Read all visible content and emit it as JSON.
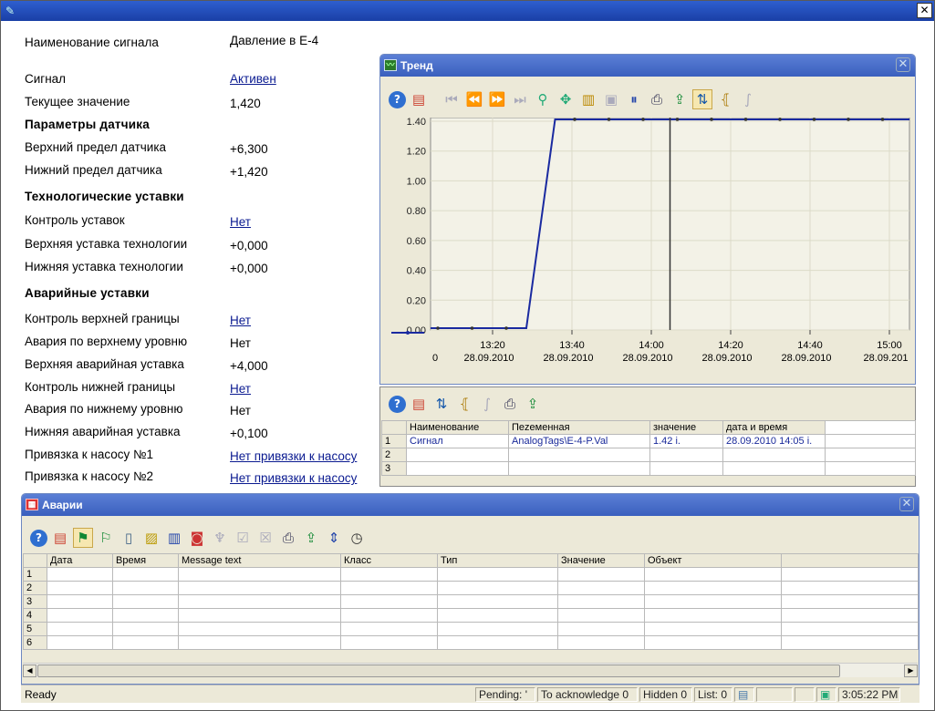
{
  "props": {
    "name_label": "Наименование сигнала",
    "name_value": "Давление в Е-4",
    "signal_label": "Сигнал",
    "signal_value": "Активен",
    "current_label": "Текущее значение",
    "current_value": "1,420",
    "sensor_section": "Параметры датчика",
    "sensor_high_label": "Верхний предел датчика",
    "sensor_high_value": "+6,300",
    "sensor_low_label": "Нижний предел датчика",
    "sensor_low_value": "+1,420",
    "tech_section": "Технологические уставки",
    "tech_ctrl_label": "Контроль уставок",
    "tech_ctrl_value": "Нет",
    "tech_high_label": "Верхняя уставка технологии",
    "tech_high_value": "+0,000",
    "tech_low_label": "Нижняя уставка технологии",
    "tech_low_value": "+0,000",
    "alarm_section": "Аварийные уставки",
    "ctrl_upper_label": "Контроль верхней границы",
    "ctrl_upper_value": "Нет",
    "alarm_upper_label": "Авария по верхнему уровню",
    "alarm_upper_value": "Нет",
    "alarm_upper_set_label": "Верхняя аварийная уставка",
    "alarm_upper_set_value": "+4,000",
    "ctrl_lower_label": "Контроль нижней границы",
    "ctrl_lower_value": "Нет",
    "alarm_lower_label": "Авария по нижнему уровню",
    "alarm_lower_value": "Нет",
    "alarm_lower_set_label": "Нижняя аварийная уставка",
    "alarm_lower_set_value": "+0,100",
    "pump1_label": "Привязка к насосу №1",
    "pump1_value": "Нет привязки к насосу",
    "pump2_label": "Привязка к насосу №2",
    "pump2_value": "Нет привязки к насосу"
  },
  "trend": {
    "title": "Тренд",
    "toolbar": [
      "help-icon",
      "properties-icon",
      "first-icon",
      "rewind-icon",
      "forward-icon",
      "last-icon",
      "zoom-icon",
      "pan-icon",
      "ruler-icon",
      "stats-icon",
      "pause-icon",
      "print-icon",
      "export-icon",
      "select-icon",
      "range-icon",
      "function-icon"
    ],
    "x0_label": "0"
  },
  "chart_data": {
    "type": "line",
    "y_ticks": [
      "1.40",
      "1.20",
      "1.00",
      "0.80",
      "0.60",
      "0.40",
      "0.20",
      "0.00"
    ],
    "ylim": [
      0,
      1.4
    ],
    "x_ticks": [
      {
        "time": "13:20",
        "date": "28.09.2010"
      },
      {
        "time": "13:40",
        "date": "28.09.2010"
      },
      {
        "time": "14:00",
        "date": "28.09.2010"
      },
      {
        "time": "14:20",
        "date": "28.09.2010"
      },
      {
        "time": "14:40",
        "date": "28.09.2010"
      },
      {
        "time": "15:00",
        "date": "28.09.201"
      }
    ],
    "series": [
      {
        "color": "#1a2aa0",
        "points": [
          [
            0,
            0
          ],
          [
            0.2,
            0
          ],
          [
            0.26,
            1.4
          ],
          [
            1,
            1.4
          ]
        ]
      }
    ],
    "cursor_x": 0.5
  },
  "table": {
    "toolbar": [
      "help-icon",
      "properties-icon",
      "select-icon",
      "range-icon",
      "function-icon",
      "print-icon",
      "export-icon"
    ],
    "headers": [
      "Наименование",
      "Пеzеменная",
      "значение",
      "дата и время",
      ""
    ],
    "rows": [
      {
        "n": "1",
        "name": "Сигнал",
        "var": "AnalogTags\\E-4-P.Val",
        "val": "1.42 i.",
        "dt": "28.09.2010 14:05 i."
      },
      {
        "n": "2",
        "name": "",
        "var": "",
        "val": "",
        "dt": ""
      },
      {
        "n": "3",
        "name": "",
        "var": "",
        "val": "",
        "dt": ""
      }
    ]
  },
  "alarms": {
    "title": "Аварии",
    "toolbar": [
      "help-icon",
      "properties-icon",
      "alarm-list-icon",
      "history-icon",
      "archive-icon",
      "lock-icon",
      "statistics-icon",
      "hide-icon",
      "filter-icon",
      "ack-icon",
      "ack-all-icon",
      "print-icon",
      "export-icon",
      "sort-icon",
      "time-icon"
    ],
    "headers": [
      "Дата",
      "Время",
      "Message text",
      "Класс",
      "Тип",
      "Значение",
      "Объект",
      ""
    ],
    "rows": [
      "1",
      "2",
      "3",
      "4",
      "5",
      "6"
    ]
  },
  "status": {
    "ready": "Ready",
    "pending": "Pending: '",
    "to_ack": "To acknowledge 0",
    "hidden": "Hidden 0",
    "list": "List: 0",
    "time": "3:05:22 PM"
  }
}
